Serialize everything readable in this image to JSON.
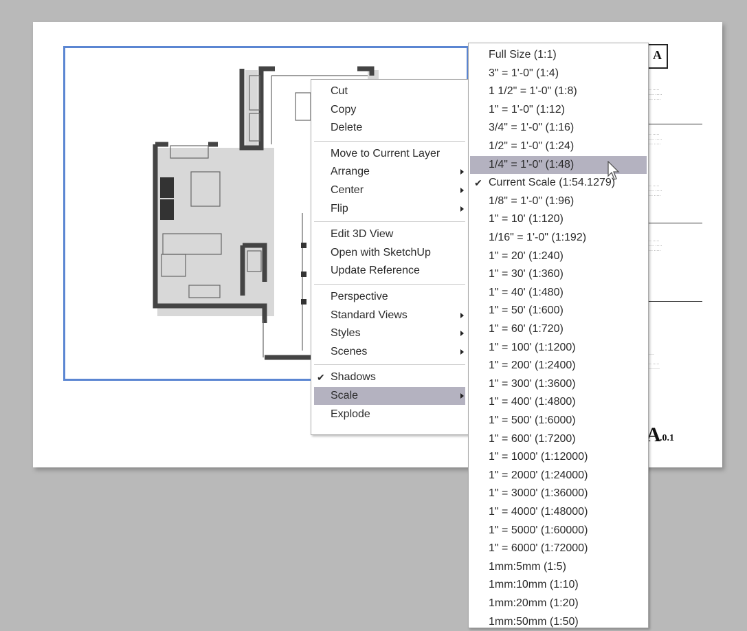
{
  "title_block": {
    "logo_letter": "A",
    "sheet_number": "A",
    "sheet_suffix": ".0.1"
  },
  "context_menu": {
    "groups": [
      [
        {
          "label": "Cut",
          "submenu": false,
          "checked": false
        },
        {
          "label": "Copy",
          "submenu": false,
          "checked": false
        },
        {
          "label": "Delete",
          "submenu": false,
          "checked": false
        }
      ],
      [
        {
          "label": "Move to Current Layer",
          "submenu": false,
          "checked": false
        },
        {
          "label": "Arrange",
          "submenu": true,
          "checked": false
        },
        {
          "label": "Center",
          "submenu": true,
          "checked": false
        },
        {
          "label": "Flip",
          "submenu": true,
          "checked": false
        }
      ],
      [
        {
          "label": "Edit 3D View",
          "submenu": false,
          "checked": false
        },
        {
          "label": "Open with SketchUp",
          "submenu": false,
          "checked": false
        },
        {
          "label": "Update Reference",
          "submenu": false,
          "checked": false
        }
      ],
      [
        {
          "label": "Perspective",
          "submenu": false,
          "checked": false
        },
        {
          "label": "Standard Views",
          "submenu": true,
          "checked": false
        },
        {
          "label": "Styles",
          "submenu": true,
          "checked": false
        },
        {
          "label": "Scenes",
          "submenu": true,
          "checked": false
        }
      ],
      [
        {
          "label": "Shadows",
          "submenu": false,
          "checked": true
        },
        {
          "label": "Scale",
          "submenu": true,
          "checked": false,
          "active": true
        },
        {
          "label": "Explode",
          "submenu": false,
          "checked": false
        }
      ]
    ]
  },
  "scale_submenu": {
    "items": [
      {
        "label": "Full Size (1:1)"
      },
      {
        "label": "3\" = 1'-0\" (1:4)"
      },
      {
        "label": "1 1/2\" = 1'-0\" (1:8)"
      },
      {
        "label": "1\" = 1'-0\" (1:12)"
      },
      {
        "label": "3/4\" = 1'-0\" (1:16)"
      },
      {
        "label": "1/2\" = 1'-0\" (1:24)"
      },
      {
        "label": "1/4\" = 1'-0\" (1:48)",
        "active": true
      },
      {
        "label": "Current Scale (1:54.1279)",
        "checked": true
      },
      {
        "label": "1/8\" = 1'-0\" (1:96)"
      },
      {
        "label": "1\" = 10' (1:120)"
      },
      {
        "label": "1/16\" = 1'-0\" (1:192)"
      },
      {
        "label": "1\" = 20' (1:240)"
      },
      {
        "label": "1\" = 30' (1:360)"
      },
      {
        "label": "1\" = 40' (1:480)"
      },
      {
        "label": "1\" = 50' (1:600)"
      },
      {
        "label": "1\" = 60' (1:720)"
      },
      {
        "label": "1\" = 100' (1:1200)"
      },
      {
        "label": "1\" = 200' (1:2400)"
      },
      {
        "label": "1\" = 300' (1:3600)"
      },
      {
        "label": "1\" = 400' (1:4800)"
      },
      {
        "label": "1\" = 500' (1:6000)"
      },
      {
        "label": "1\" = 600' (1:7200)"
      },
      {
        "label": "1\" = 1000' (1:12000)"
      },
      {
        "label": "1\" = 2000' (1:24000)"
      },
      {
        "label": "1\" = 3000' (1:36000)"
      },
      {
        "label": "1\" = 4000' (1:48000)"
      },
      {
        "label": "1\" = 5000' (1:60000)"
      },
      {
        "label": "1\" = 6000' (1:72000)"
      },
      {
        "label": "1mm:5mm (1:5)"
      },
      {
        "label": "1mm:10mm (1:10)"
      },
      {
        "label": "1mm:20mm (1:20)"
      },
      {
        "label": "1mm:50mm (1:50)"
      }
    ]
  }
}
